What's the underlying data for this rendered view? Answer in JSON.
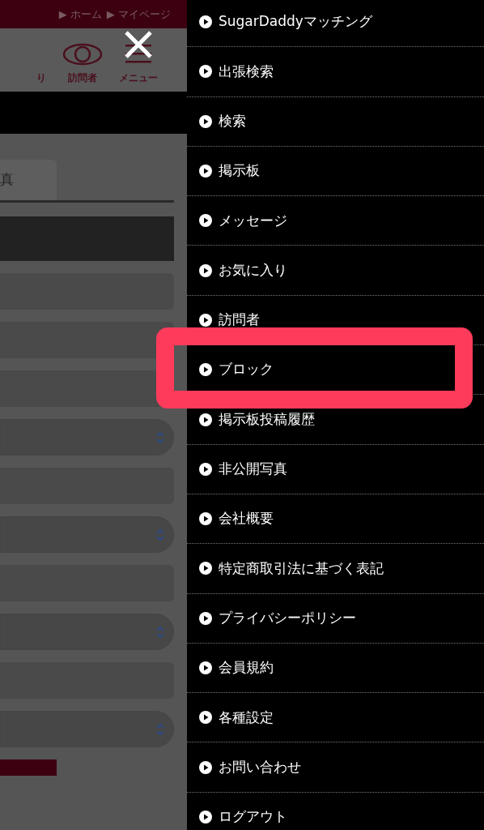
{
  "breadcrumb": [
    "▶ ホーム",
    "▶ マイページ"
  ],
  "nav": [
    {
      "label": "り",
      "kind": "plain"
    },
    {
      "label": "訪問者",
      "kind": "visitors"
    },
    {
      "label": "メニュー",
      "kind": "menu"
    }
  ],
  "tabs": [
    {
      "label": "真"
    }
  ],
  "form_fields": [
    {
      "kind": "input"
    },
    {
      "kind": "input"
    },
    {
      "kind": "input"
    },
    {
      "kind": "select"
    },
    {
      "kind": "input"
    },
    {
      "kind": "select"
    },
    {
      "kind": "input"
    },
    {
      "kind": "select"
    },
    {
      "kind": "input"
    },
    {
      "kind": "select"
    },
    {
      "kind": "button"
    }
  ],
  "menu": {
    "items": [
      {
        "label": "SugarDaddyマッチング",
        "highlighted": false
      },
      {
        "label": "出張検索",
        "highlighted": false
      },
      {
        "label": "検索",
        "highlighted": false
      },
      {
        "label": "掲示板",
        "highlighted": false
      },
      {
        "label": "メッセージ",
        "highlighted": false
      },
      {
        "label": "お気に入り",
        "highlighted": false
      },
      {
        "label": "訪問者",
        "highlighted": false
      },
      {
        "label": "ブロック",
        "highlighted": true
      },
      {
        "label": "掲示板投稿履歴",
        "highlighted": false
      },
      {
        "label": "非公開写真",
        "highlighted": false
      },
      {
        "label": "会社概要",
        "highlighted": false
      },
      {
        "label": "特定商取引法に基づく表記",
        "highlighted": false
      },
      {
        "label": "プライバシーポリシー",
        "highlighted": false
      },
      {
        "label": "会員規約",
        "highlighted": false
      },
      {
        "label": "各種設定",
        "highlighted": false
      },
      {
        "label": "お問い合わせ",
        "highlighted": false
      },
      {
        "label": "ログアウト",
        "highlighted": false
      }
    ]
  }
}
